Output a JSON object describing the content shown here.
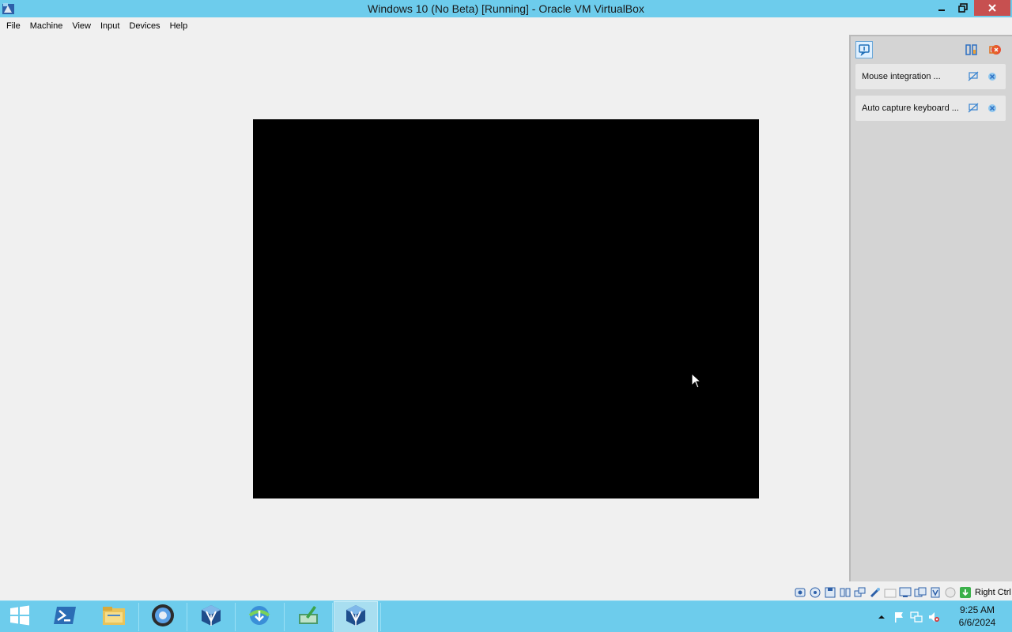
{
  "window": {
    "title": "Windows 10 (No Beta) [Running] - Oracle VM VirtualBox",
    "app_icon": "virtualbox-icon",
    "controls": [
      "minimize-icon",
      "restore-icon",
      "close-icon"
    ]
  },
  "menu": {
    "items": [
      {
        "label": "File"
      },
      {
        "label": "Machine"
      },
      {
        "label": "View"
      },
      {
        "label": "Input"
      },
      {
        "label": "Devices"
      },
      {
        "label": "Help"
      }
    ]
  },
  "notifications": {
    "header_icons": [
      "message-icon",
      "dock-icon",
      "close-all-icon"
    ],
    "items": [
      {
        "text": "Mouse integration ...",
        "icons": [
          "suppress-icon",
          "close-icon"
        ]
      },
      {
        "text": "Auto capture keyboard ...",
        "icons": [
          "suppress-icon",
          "close-icon"
        ]
      }
    ]
  },
  "statusbar": {
    "icons": [
      "hard-disk-icon",
      "optical-drive-icon",
      "floppy-icon",
      "audio-icon",
      "network-icon",
      "usb-icon",
      "shared-folders-icon",
      "display-icon",
      "recording-icon",
      "cpu-icon",
      "mouse-integration-icon",
      "host-key-icon"
    ],
    "host_key": "Right Ctrl"
  },
  "taskbar": {
    "buttons": [
      {
        "icon": "start-icon"
      },
      {
        "icon": "powershell-icon"
      },
      {
        "icon": "file-explorer-icon"
      },
      {
        "icon": "browser-icon"
      },
      {
        "icon": "virtualbox-icon"
      },
      {
        "icon": "download-manager-icon"
      },
      {
        "icon": "notepad-icon"
      },
      {
        "icon": "virtualbox-vm-icon"
      }
    ],
    "tray_icons": [
      "show-hidden-icon",
      "action-center-flag-icon",
      "network-icon",
      "volume-muted-icon"
    ],
    "clock": {
      "time": "9:25 AM",
      "date": "6/6/2024"
    }
  },
  "colors": {
    "accent": "#6dccec",
    "close": "#c75050",
    "vm_screen": "#000000"
  }
}
